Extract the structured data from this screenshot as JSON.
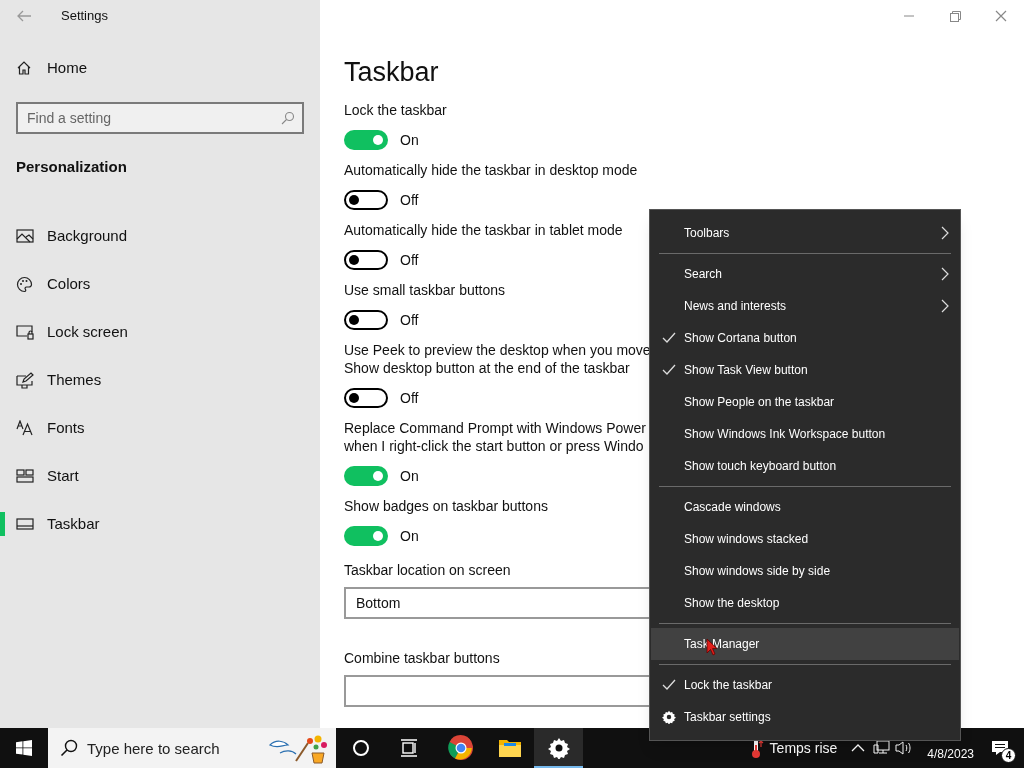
{
  "window": {
    "title": "Settings"
  },
  "sidebar": {
    "home": "Home",
    "search": {
      "placeholder": "Find a setting"
    },
    "section": "Personalization",
    "items": [
      {
        "label": "Background",
        "selected": false
      },
      {
        "label": "Colors",
        "selected": false
      },
      {
        "label": "Lock screen",
        "selected": false
      },
      {
        "label": "Themes",
        "selected": false
      },
      {
        "label": "Fonts",
        "selected": false
      },
      {
        "label": "Start",
        "selected": false
      },
      {
        "label": "Taskbar",
        "selected": true
      }
    ]
  },
  "page": {
    "title": "Taskbar",
    "settings": [
      {
        "kind": "toggle",
        "label": "Lock the taskbar",
        "on": true,
        "state_label": "On"
      },
      {
        "kind": "toggle",
        "label": "Automatically hide the taskbar in desktop mode",
        "on": false,
        "state_label": "Off"
      },
      {
        "kind": "toggle",
        "label": "Automatically hide the taskbar in tablet mode",
        "on": false,
        "state_label": "Off"
      },
      {
        "kind": "toggle",
        "label": "Use small taskbar buttons",
        "on": false,
        "state_label": "Off"
      },
      {
        "kind": "toggle",
        "label": "Use Peek to preview the desktop when you move\nShow desktop button at the end of the taskbar",
        "on": false,
        "state_label": "Off"
      },
      {
        "kind": "toggle",
        "label": "Replace Command Prompt with Windows Power\nwhen I right-click the start button or press Windo",
        "on": true,
        "state_label": "On"
      },
      {
        "kind": "toggle",
        "label": "Show badges on taskbar buttons",
        "on": true,
        "state_label": "On"
      },
      {
        "kind": "dropdown",
        "label": "Taskbar location on screen",
        "value": "Bottom"
      },
      {
        "kind": "dropdown",
        "label": "Combine taskbar buttons"
      }
    ]
  },
  "context_menu": {
    "items": [
      {
        "kind": "item",
        "label": "Toolbars",
        "submenu": true,
        "checked": false,
        "selected": false
      },
      {
        "kind": "separator"
      },
      {
        "kind": "item",
        "label": "Search",
        "submenu": true,
        "checked": false,
        "selected": false
      },
      {
        "kind": "item",
        "label": "News and interests",
        "submenu": true,
        "checked": false,
        "selected": false
      },
      {
        "kind": "item",
        "label": "Show Cortana button",
        "submenu": false,
        "checked": true,
        "selected": false
      },
      {
        "kind": "item",
        "label": "Show Task View button",
        "submenu": false,
        "checked": true,
        "selected": false
      },
      {
        "kind": "item",
        "label": "Show People on the taskbar",
        "submenu": false,
        "checked": false,
        "selected": false
      },
      {
        "kind": "item",
        "label": "Show Windows Ink Workspace button",
        "submenu": false,
        "checked": false,
        "selected": false
      },
      {
        "kind": "item",
        "label": "Show touch keyboard button",
        "submenu": false,
        "checked": false,
        "selected": false
      },
      {
        "kind": "separator"
      },
      {
        "kind": "item",
        "label": "Cascade windows",
        "submenu": false,
        "checked": false,
        "selected": false
      },
      {
        "kind": "item",
        "label": "Show windows stacked",
        "submenu": false,
        "checked": false,
        "selected": false
      },
      {
        "kind": "item",
        "label": "Show windows side by side",
        "submenu": false,
        "checked": false,
        "selected": false
      },
      {
        "kind": "item",
        "label": "Show the desktop",
        "submenu": false,
        "checked": false,
        "selected": false
      },
      {
        "kind": "separator"
      },
      {
        "kind": "item",
        "label": "Task Manager",
        "submenu": false,
        "checked": false,
        "selected": true
      },
      {
        "kind": "separator"
      },
      {
        "kind": "item",
        "label": "Lock the taskbar",
        "submenu": false,
        "checked": true,
        "selected": false
      },
      {
        "kind": "settings",
        "label": "Taskbar settings",
        "submenu": false,
        "checked": false,
        "selected": false
      }
    ]
  },
  "taskbar": {
    "search": {
      "placeholder": "Type here to search"
    },
    "apps": [
      {
        "selected": false
      },
      {
        "selected": false
      },
      {
        "selected": true
      }
    ],
    "weather": "Temps rise",
    "date": "4/8/2023",
    "notification_count": "4"
  }
}
